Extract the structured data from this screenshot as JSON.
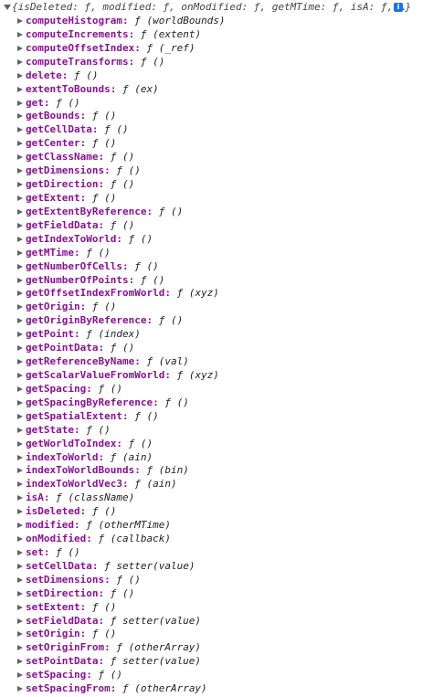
{
  "header": {
    "summary": "{isDeleted: ƒ, modified: ƒ, onModified: ƒ, getMTime: ƒ, isA: ƒ, …}",
    "info_icon": "i"
  },
  "properties": [
    {
      "name": "computeHistogram:",
      "value": "ƒ (worldBounds)"
    },
    {
      "name": "computeIncrements:",
      "value": "ƒ (extent)"
    },
    {
      "name": "computeOffsetIndex:",
      "value": "ƒ (_ref)"
    },
    {
      "name": "computeTransforms:",
      "value": "ƒ ()"
    },
    {
      "name": "delete:",
      "value": "ƒ ()"
    },
    {
      "name": "extentToBounds:",
      "value": "ƒ (ex)"
    },
    {
      "name": "get:",
      "value": "ƒ ()"
    },
    {
      "name": "getBounds:",
      "value": "ƒ ()"
    },
    {
      "name": "getCellData:",
      "value": "ƒ ()"
    },
    {
      "name": "getCenter:",
      "value": "ƒ ()"
    },
    {
      "name": "getClassName:",
      "value": "ƒ ()"
    },
    {
      "name": "getDimensions:",
      "value": "ƒ ()"
    },
    {
      "name": "getDirection:",
      "value": "ƒ ()"
    },
    {
      "name": "getExtent:",
      "value": "ƒ ()"
    },
    {
      "name": "getExtentByReference:",
      "value": "ƒ ()"
    },
    {
      "name": "getFieldData:",
      "value": "ƒ ()"
    },
    {
      "name": "getIndexToWorld:",
      "value": "ƒ ()"
    },
    {
      "name": "getMTime:",
      "value": "ƒ ()"
    },
    {
      "name": "getNumberOfCells:",
      "value": "ƒ ()"
    },
    {
      "name": "getNumberOfPoints:",
      "value": "ƒ ()"
    },
    {
      "name": "getOffsetIndexFromWorld:",
      "value": "ƒ (xyz)"
    },
    {
      "name": "getOrigin:",
      "value": "ƒ ()"
    },
    {
      "name": "getOriginByReference:",
      "value": "ƒ ()"
    },
    {
      "name": "getPoint:",
      "value": "ƒ (index)"
    },
    {
      "name": "getPointData:",
      "value": "ƒ ()"
    },
    {
      "name": "getReferenceByName:",
      "value": "ƒ (val)"
    },
    {
      "name": "getScalarValueFromWorld:",
      "value": "ƒ (xyz)"
    },
    {
      "name": "getSpacing:",
      "value": "ƒ ()"
    },
    {
      "name": "getSpacingByReference:",
      "value": "ƒ ()"
    },
    {
      "name": "getSpatialExtent:",
      "value": "ƒ ()"
    },
    {
      "name": "getState:",
      "value": "ƒ ()"
    },
    {
      "name": "getWorldToIndex:",
      "value": "ƒ ()"
    },
    {
      "name": "indexToWorld:",
      "value": "ƒ (ain)"
    },
    {
      "name": "indexToWorldBounds:",
      "value": "ƒ (bin)"
    },
    {
      "name": "indexToWorldVec3:",
      "value": "ƒ (ain)"
    },
    {
      "name": "isA:",
      "value": "ƒ (className)"
    },
    {
      "name": "isDeleted:",
      "value": "ƒ ()"
    },
    {
      "name": "modified:",
      "value": "ƒ (otherMTime)"
    },
    {
      "name": "onModified:",
      "value": "ƒ (callback)"
    },
    {
      "name": "set:",
      "value": "ƒ ()"
    },
    {
      "name": "setCellData:",
      "value": "ƒ setter(value)"
    },
    {
      "name": "setDimensions:",
      "value": "ƒ ()"
    },
    {
      "name": "setDirection:",
      "value": "ƒ ()"
    },
    {
      "name": "setExtent:",
      "value": "ƒ ()"
    },
    {
      "name": "setFieldData:",
      "value": "ƒ setter(value)"
    },
    {
      "name": "setOrigin:",
      "value": "ƒ ()"
    },
    {
      "name": "setOriginFrom:",
      "value": "ƒ (otherArray)"
    },
    {
      "name": "setPointData:",
      "value": "ƒ setter(value)"
    },
    {
      "name": "setSpacing:",
      "value": "ƒ ()"
    },
    {
      "name": "setSpacingFrom:",
      "value": "ƒ (otherArray)"
    }
  ],
  "colors": {
    "property_name": "#881391",
    "value_text": "#222222",
    "arrow": "#5f6368",
    "info_icon_bg": "#1a73e8"
  },
  "icons": {
    "expand_arrow": "triangle-right-icon",
    "collapse_arrow": "triangle-down-icon",
    "info": "info-icon"
  }
}
